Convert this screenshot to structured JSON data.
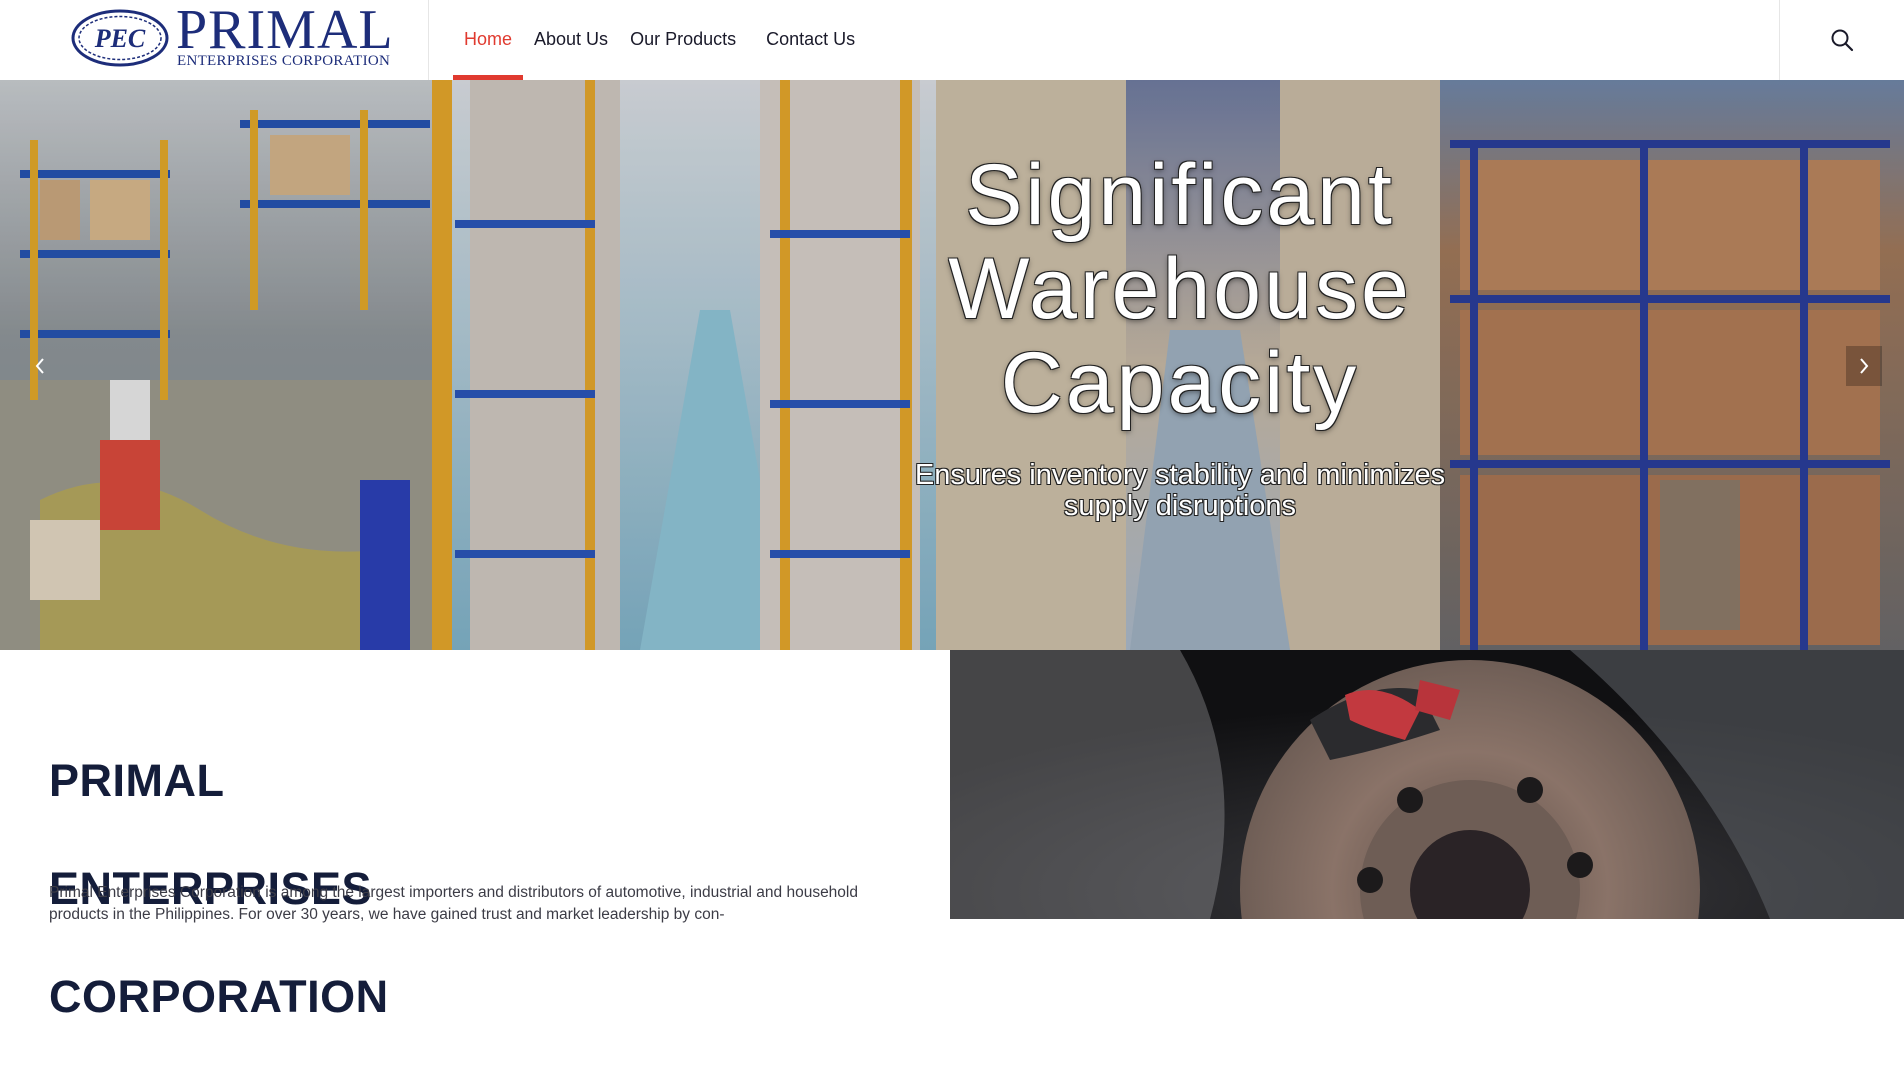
{
  "logo": {
    "mark": "PEC",
    "word": "PRIMAL",
    "sub": "ENTERPRISES CORPORATION",
    "brand_color": "#1d2d7a"
  },
  "nav": {
    "items": [
      {
        "label": "Home",
        "active": true
      },
      {
        "label": "About Us"
      },
      {
        "label": "Our Products"
      },
      {
        "label": "Contact Us"
      }
    ],
    "active_color": "#e03a2f"
  },
  "hero": {
    "title_lines": [
      "Significant",
      "Warehouse",
      "Capacity"
    ],
    "subtitle_lines": [
      "Ensures inventory stability and minimizes",
      "supply disruptions"
    ]
  },
  "about": {
    "title_lines": [
      "PRIMAL",
      "ENTERPRISES",
      "CORPORATION"
    ],
    "text": "Primal Enterprises Corporation is among the largest importers and distributors of automotive, industrial and household products in the Philippines. For over 30 years, we have gained trust and market leadership by con-"
  },
  "icons": {
    "search": "search-icon",
    "prev": "chevron-left-icon",
    "next": "chevron-right-icon"
  }
}
